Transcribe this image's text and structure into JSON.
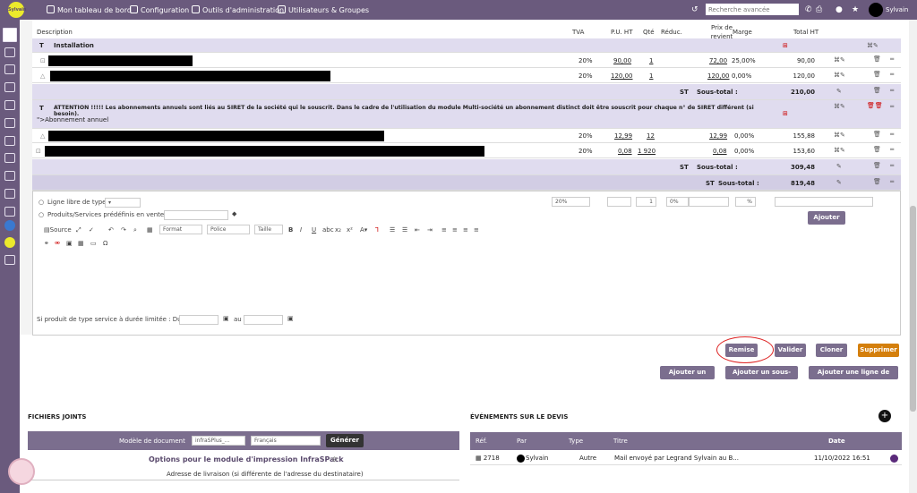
{
  "topbar": {
    "logo": "Sylvain",
    "nav": [
      "Mon tableau de bord",
      "Configuration",
      "Outils d'administration",
      "Utilisateurs & Groupes"
    ],
    "search_placeholder": "Recherche avancée",
    "user": "Sylvain"
  },
  "table": {
    "headers": {
      "description": "Description",
      "tva": "TVA",
      "puht": "P.U. HT",
      "qte": "Qté",
      "reduc": "Réduc.",
      "prix": "Prix de revient",
      "marge": "Marge",
      "total": "Total HT"
    },
    "rows": [
      {
        "kind": "title",
        "label": "Installation"
      },
      {
        "kind": "line",
        "tva": "20%",
        "pu": "90,00",
        "qte": "1",
        "red": "",
        "prix": "72,00",
        "marge": "25,00%",
        "total": "90,00"
      },
      {
        "kind": "line",
        "tva": "20%",
        "pu": "120,00",
        "qte": "1",
        "red": "",
        "prix": "120,00",
        "marge": "0,00%",
        "total": "120,00"
      },
      {
        "kind": "sub",
        "label": "Sous-total :",
        "total": "210,00"
      },
      {
        "kind": "note",
        "label": "ATTENTION !!!!! Les abonnements annuels sont liés au SIRET de la société qui le souscrit. Dans le cadre de l'utilisation du module Multi-société un abonnement distinct doit être souscrit pour chaque n° de SIRET différent (si besoin).",
        "sub": "\">Abonnement annuel"
      },
      {
        "kind": "line",
        "tva": "20%",
        "pu": "12,99",
        "qte": "12",
        "red": "",
        "prix": "12,99",
        "marge": "0,00%",
        "total": "155,88"
      },
      {
        "kind": "line",
        "tva": "20%",
        "pu": "0,08",
        "qte": "1 920",
        "red": "",
        "prix": "0,08",
        "marge": "0,00%",
        "total": "153,60"
      },
      {
        "kind": "sub",
        "label": "Sous-total :",
        "total": "309,48"
      },
      {
        "kind": "sub2",
        "label": "Sous-total :",
        "total": "819,48"
      }
    ]
  },
  "form": {
    "opt1": "Ligne libre de type",
    "opt2": "Produits/Services prédéfinis en vente",
    "tva": "20%",
    "qty": "1",
    "reduc": "0%",
    "pct": "%",
    "add": "Ajouter",
    "source": "Source",
    "format": "Format",
    "police": "Police",
    "taille": "Taille",
    "dates": "Si produit de type service à durée limitée : Du",
    "au": "au"
  },
  "actions": {
    "remise": "Remise",
    "valider": "Valider",
    "cloner": "Cloner",
    "supprimer": "Supprimer",
    "add_title": "Ajouter un titre",
    "add_subtotal": "Ajouter un sous-total",
    "add_text": "Ajouter une ligne de texte"
  },
  "files": {
    "title": "FICHIERS JOINTS",
    "model_label": "Modèle de document",
    "model_value": "infraSPlus_...",
    "lang": "Français",
    "generate": "Générer",
    "options_title": "Options pour le module d'impression InfraSPack",
    "address": "Adresse de livraison (si différente de l'adresse du destinataire)"
  },
  "events": {
    "title": "ÉVÉNEMENTS SUR LE DEVIS",
    "headers": [
      "Réf.",
      "Par",
      "Type",
      "Titre",
      "Date"
    ],
    "row": {
      "ref": "2718",
      "par": "Sylvain",
      "type": "Autre",
      "titre": "Mail envoyé par Legrand Sylvain au B...",
      "date": "11/10/2022 16:51"
    }
  }
}
